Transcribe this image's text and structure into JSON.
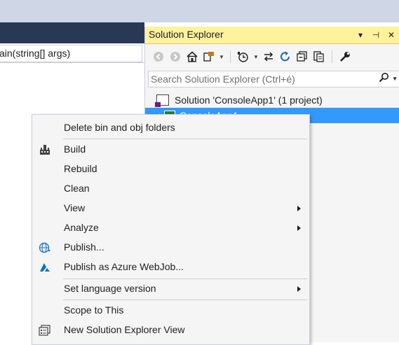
{
  "editor": {
    "method_combo": "ain(string[] args)"
  },
  "solution_explorer": {
    "title": "Solution Explorer",
    "title_buttons": [
      "▾",
      "⊣",
      "✕"
    ],
    "search_placeholder": "Search Solution Explorer (Ctrl+é)",
    "tree": {
      "solution_label": "Solution 'ConsoleApp1' (1 project)",
      "project_label": "ConsoleApp1"
    }
  },
  "context_menu": {
    "items": [
      {
        "label": "Delete bin and obj folders",
        "icon": null,
        "submenu": false
      },
      {
        "label": "Build",
        "icon": "build-icon",
        "submenu": false
      },
      {
        "label": "Rebuild",
        "icon": null,
        "submenu": false
      },
      {
        "label": "Clean",
        "icon": null,
        "submenu": false
      },
      {
        "label": "View",
        "icon": null,
        "submenu": true
      },
      {
        "label": "Analyze",
        "icon": null,
        "submenu": true
      },
      {
        "label": "Publish...",
        "icon": "publish-globe-icon",
        "submenu": false
      },
      {
        "label": "Publish as Azure WebJob...",
        "icon": "azure-icon",
        "submenu": false
      },
      {
        "label": "Set language version",
        "icon": null,
        "submenu": true
      },
      {
        "label": "Scope to This",
        "icon": null,
        "submenu": false
      },
      {
        "label": "New Solution Explorer View",
        "icon": "new-view-icon",
        "submenu": false
      }
    ]
  },
  "colors": {
    "selection": "#3399ff",
    "title_active": "#fff29d",
    "azure": "#0072c6",
    "vs_purple": "#68217a"
  }
}
